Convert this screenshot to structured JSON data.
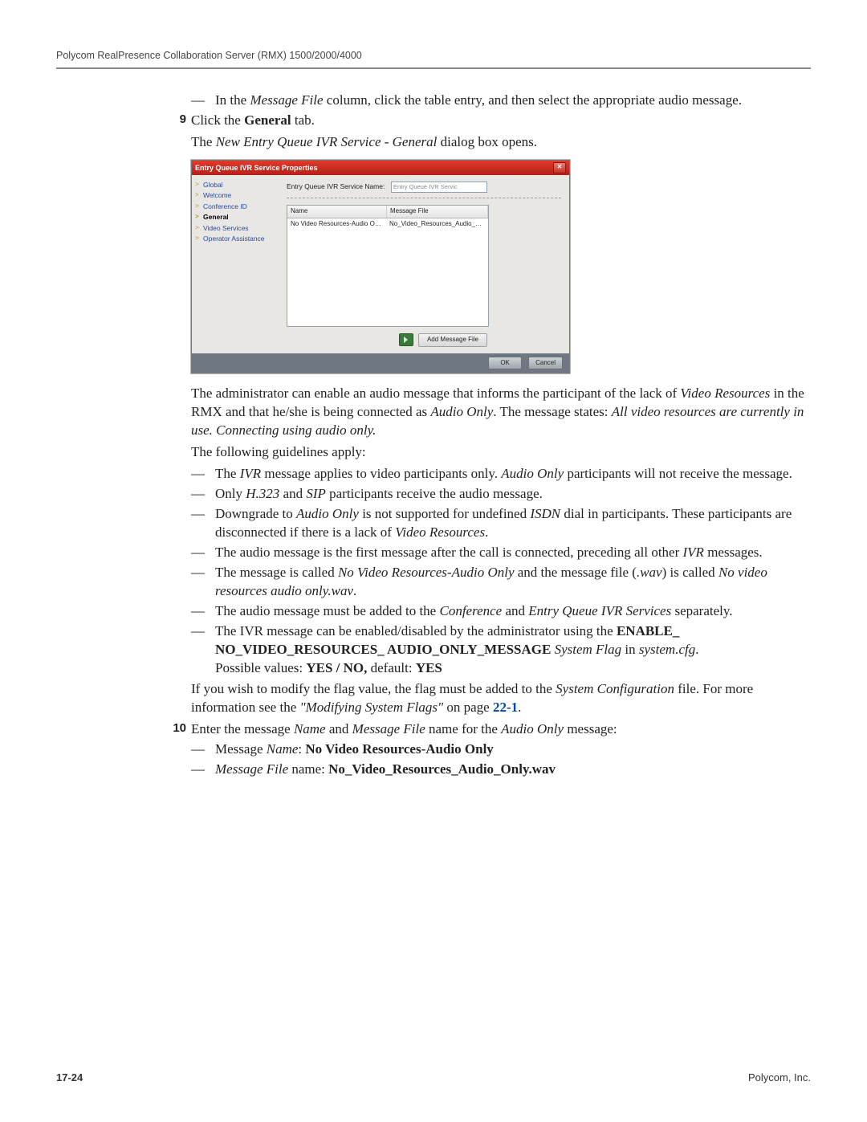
{
  "header": {
    "running_head": "Polycom RealPresence Collaboration Server (RMX) 1500/2000/4000"
  },
  "body": {
    "pre_dash_prefix": "— ",
    "pre_dash_a": "In the ",
    "pre_dash_b_italic": "Message File",
    "pre_dash_c": " column, click the table entry, and then select the appropriate audio message.",
    "step9_num": "9",
    "step9_a": "Click the ",
    "step9_b_bold": "General",
    "step9_c": " tab.",
    "step9_sub_a": "The ",
    "step9_sub_b_italic": "New Entry Queue IVR Service - General",
    "step9_sub_c": " dialog box opens.",
    "admin_a": "The administrator can enable an audio message that informs the participant of the lack of ",
    "admin_b_italic": "Video Resources",
    "admin_c": " in the RMX and that he/she is being connected as ",
    "admin_d_italic": "Audio Only",
    "admin_e": ". The message states: ",
    "admin_f_italic": "All video resources are currently in use. Connecting using audio only.",
    "guidelines_intro": "The following guidelines apply:",
    "g1_a": "The ",
    "g1_b_italic": "IVR",
    "g1_c": " message applies to video participants only. ",
    "g1_d_italic": "Audio Only",
    "g1_e": " participants will not receive the message.",
    "g2_a": "Only ",
    "g2_b_italic": "H.323",
    "g2_c": " and ",
    "g2_d_italic": "SIP",
    "g2_e": " participants receive the audio message.",
    "g3_a": "Downgrade to ",
    "g3_b_italic": "Audio Only",
    "g3_c": " is not supported for undefined ",
    "g3_d_italic": "ISDN",
    "g3_e": " dial in participants. These participants are disconnected if there is a lack of ",
    "g3_f_italic": "Video Resources",
    "g3_g": ".",
    "g4_a": "The audio message is the first message after the call is connected, preceding all other ",
    "g4_b_italic": "IVR",
    "g4_c": " messages.",
    "g5_a": "The message is called ",
    "g5_b_italic": "No Video Resources-Audio Only",
    "g5_c": " and the message file (",
    "g5_d_italic": ".wav",
    "g5_e": ") is called ",
    "g5_f_italic": "No video resources audio only.wav",
    "g5_g": ".",
    "g6_a": "The audio message must be added to the ",
    "g6_b_italic": "Conference",
    "g6_c": " and ",
    "g6_d_italic": "Entry Queue IVR Services",
    "g6_e": " separately.",
    "g7_a": "The IVR message can be enabled/disabled by the administrator using the ",
    "g7_b_bold": "ENABLE_ NO_VIDEO_RESOURCES_ AUDIO_ONLY_MESSAGE ",
    "g7_c_italic": "System Flag",
    "g7_d": " in ",
    "g7_e_italic": "system.cfg",
    "g7_f": ".",
    "g7_values_a": "Possible values: ",
    "g7_values_b_bold": "YES / NO,",
    "g7_values_c": " default: ",
    "g7_values_d_bold": "YES",
    "flag_a": "If you wish to modify the flag value, the flag must be added to the ",
    "flag_b_italic": "System Configuration",
    "flag_c": " file. For more information see the ",
    "flag_d_quoted_italic": "\"Modifying System Flags\"",
    "flag_e": " on page ",
    "flag_f_link": "22-1",
    "flag_g": ".",
    "step10_num": "10",
    "step10_a": "Enter the message ",
    "step10_b_italic": "Name",
    "step10_c": " and ",
    "step10_d_italic": "Message File",
    "step10_e": " name for the ",
    "step10_f_italic": "Audio Only",
    "step10_g": " message:",
    "s10_1_a": "Message ",
    "s10_1_b_italic": "Name",
    "s10_1_c": ": ",
    "s10_1_d_bold": "No Video Resources-Audio Only",
    "s10_2_a_italic": "Message File",
    "s10_2_b": " name: ",
    "s10_2_c_bold": "No_Video_Resources_Audio_Only.wav"
  },
  "dialog": {
    "title": "Entry Queue IVR Service Properties",
    "nav": {
      "global": "Global",
      "welcome": "Welcome",
      "conference_id": "Conference ID",
      "general": "General",
      "video_services": "Video Services",
      "operator_assistance": "Operator Assistance"
    },
    "service_name_label": "Entry Queue IVR Service Name:",
    "service_name_value": "Entry Queue IVR Servic",
    "table": {
      "col_name": "Name",
      "col_msgfile": "Message File",
      "row_name": "No Video Resources-Audio Only",
      "row_file": "No_Video_Resources_Audio_Only.wav"
    },
    "add_btn": "Add Message File",
    "ok": "OK",
    "cancel": "Cancel"
  },
  "footer": {
    "page_num": "17-24",
    "company": "Polycom, Inc."
  }
}
